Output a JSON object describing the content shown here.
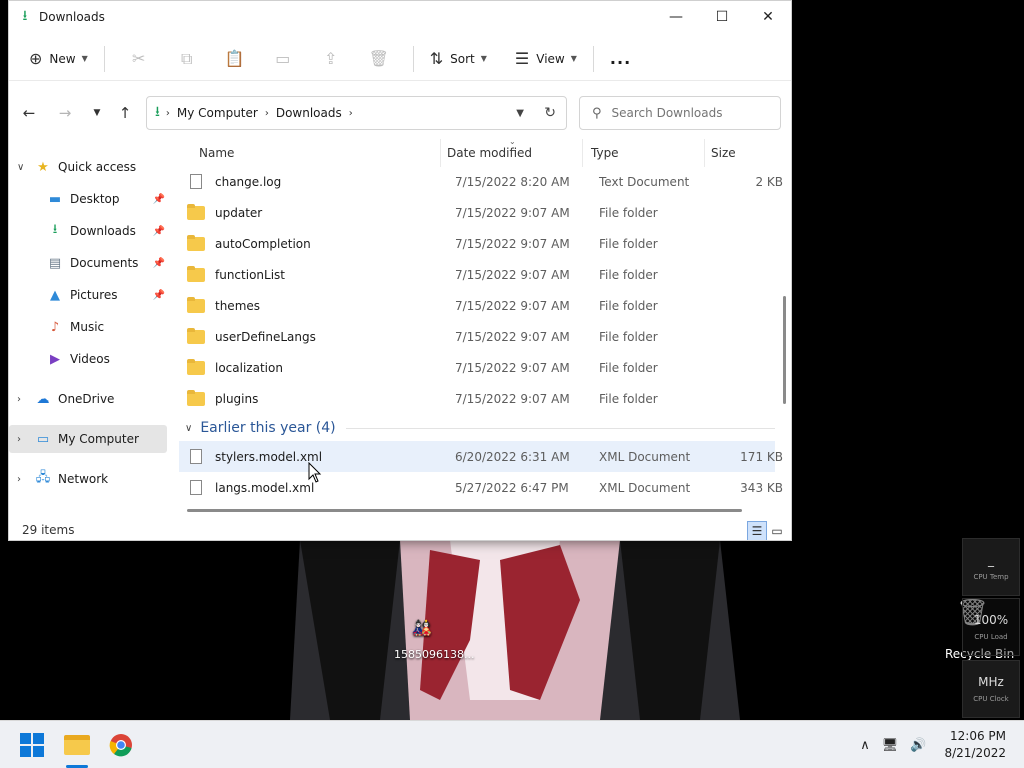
{
  "window": {
    "title": "Downloads"
  },
  "toolbar": {
    "new_label": "New",
    "sort_label": "Sort",
    "view_label": "View",
    "more_label": "..."
  },
  "address": {
    "crumbs": [
      "My Computer",
      "Downloads"
    ]
  },
  "search": {
    "placeholder": "Search Downloads"
  },
  "sidebar": {
    "items": [
      {
        "label": "Quick access",
        "icon": "star-icon",
        "expanded": true
      },
      {
        "label": "Desktop",
        "icon": "desktop-icon",
        "pinned": true
      },
      {
        "label": "Downloads",
        "icon": "download-icon",
        "pinned": true
      },
      {
        "label": "Documents",
        "icon": "documents-icon",
        "pinned": true
      },
      {
        "label": "Pictures",
        "icon": "pictures-icon",
        "pinned": true
      },
      {
        "label": "Music",
        "icon": "music-icon"
      },
      {
        "label": "Videos",
        "icon": "videos-icon"
      },
      {
        "label": "OneDrive",
        "icon": "cloud-icon",
        "expanded": false
      },
      {
        "label": "My Computer",
        "icon": "computer-icon",
        "selected": true
      },
      {
        "label": "Network",
        "icon": "network-icon"
      }
    ]
  },
  "columns": [
    "Name",
    "Date modified",
    "Type",
    "Size"
  ],
  "files": [
    {
      "name": "change.log",
      "date": "7/15/2022 8:20 AM",
      "type": "Text Document",
      "size": "2 KB",
      "icon": "text-file-icon"
    },
    {
      "name": "updater",
      "date": "7/15/2022 9:07 AM",
      "type": "File folder",
      "size": "",
      "icon": "folder-icon"
    },
    {
      "name": "autoCompletion",
      "date": "7/15/2022 9:07 AM",
      "type": "File folder",
      "size": "",
      "icon": "folder-icon"
    },
    {
      "name": "functionList",
      "date": "7/15/2022 9:07 AM",
      "type": "File folder",
      "size": "",
      "icon": "folder-icon"
    },
    {
      "name": "themes",
      "date": "7/15/2022 9:07 AM",
      "type": "File folder",
      "size": "",
      "icon": "folder-icon"
    },
    {
      "name": "userDefineLangs",
      "date": "7/15/2022 9:07 AM",
      "type": "File folder",
      "size": "",
      "icon": "folder-icon"
    },
    {
      "name": "localization",
      "date": "7/15/2022 9:07 AM",
      "type": "File folder",
      "size": "",
      "icon": "folder-icon"
    },
    {
      "name": "plugins",
      "date": "7/15/2022 9:07 AM",
      "type": "File folder",
      "size": "",
      "icon": "folder-icon"
    }
  ],
  "group": {
    "label": "Earlier this year (4)"
  },
  "group_files": [
    {
      "name": "stylers.model.xml",
      "date": "6/20/2022 6:31 AM",
      "type": "XML Document",
      "size": "171 KB",
      "icon": "xml-file-icon"
    },
    {
      "name": "langs.model.xml",
      "date": "5/27/2022 6:47 PM",
      "type": "XML Document",
      "size": "343 KB",
      "icon": "xml-file-icon"
    }
  ],
  "status": {
    "item_count": "29 items"
  },
  "desktop": {
    "file_label": "1585096138...",
    "recycle_label": "Recycle Bin",
    "widgets": [
      {
        "value": "_",
        "label": "CPU Temp"
      },
      {
        "value": "100%",
        "label": "CPU Load"
      },
      {
        "value": "MHz",
        "label": "CPU Clock"
      }
    ]
  },
  "taskbar": {
    "time": "12:06 PM",
    "date": "8/21/2022"
  }
}
